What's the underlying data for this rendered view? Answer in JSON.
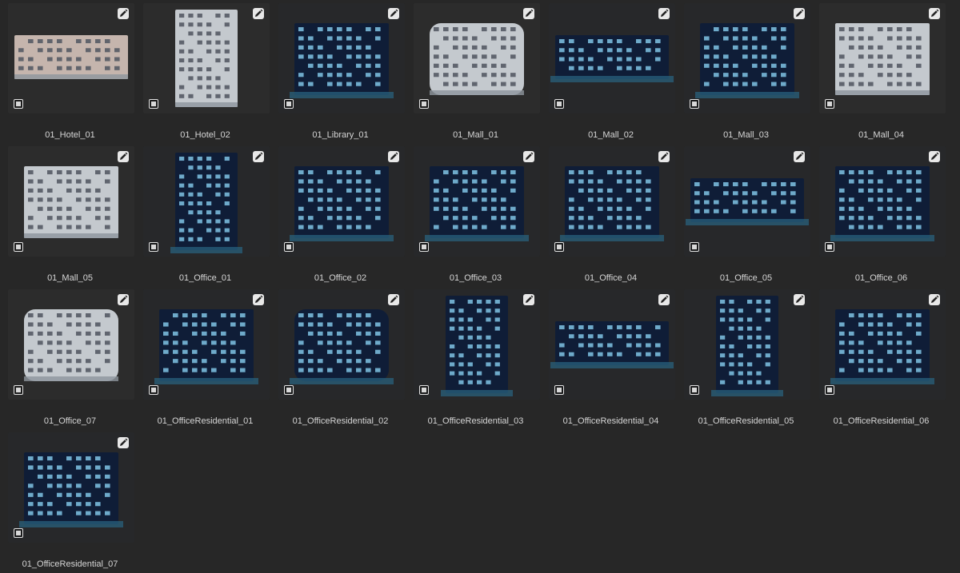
{
  "assets": [
    {
      "label": "01_Hotel_01",
      "style": "day-low"
    },
    {
      "label": "01_Hotel_02",
      "style": "day-tower"
    },
    {
      "label": "01_Library_01",
      "style": "night-pavilion"
    },
    {
      "label": "01_Mall_01",
      "style": "day-curved"
    },
    {
      "label": "01_Mall_02",
      "style": "night-wide"
    },
    {
      "label": "01_Mall_03",
      "style": "night-stripes"
    },
    {
      "label": "01_Mall_04",
      "style": "day-stacked"
    },
    {
      "label": "01_Mall_05",
      "style": "day-classic"
    },
    {
      "label": "01_Office_01",
      "style": "night-tower"
    },
    {
      "label": "01_Office_02",
      "style": "night-boxes"
    },
    {
      "label": "01_Office_03",
      "style": "night-overhang"
    },
    {
      "label": "01_Office_04",
      "style": "night-wave"
    },
    {
      "label": "01_Office_05",
      "style": "night-flat"
    },
    {
      "label": "01_Office_06",
      "style": "night-block"
    },
    {
      "label": "01_Office_07",
      "style": "day-rounded"
    },
    {
      "label": "01_OfficeResidential_01",
      "style": "night-cluster"
    },
    {
      "label": "01_OfficeResidential_02",
      "style": "night-arch"
    },
    {
      "label": "01_OfficeResidential_03",
      "style": "night-twin"
    },
    {
      "label": "01_OfficeResidential_04",
      "style": "night-low"
    },
    {
      "label": "01_OfficeResidential_05",
      "style": "night-towers"
    },
    {
      "label": "01_OfficeResidential_06",
      "style": "night-complex"
    },
    {
      "label": "01_OfficeResidential_07",
      "style": "night-isometric"
    }
  ],
  "icons": {
    "edit": "pencil-icon",
    "select": "checkbox-icon"
  },
  "colors": {
    "background": "#272727",
    "label": "#d6d6d6",
    "night_glow": "#7fd3ff",
    "day_wall": "#e6e2dc"
  }
}
